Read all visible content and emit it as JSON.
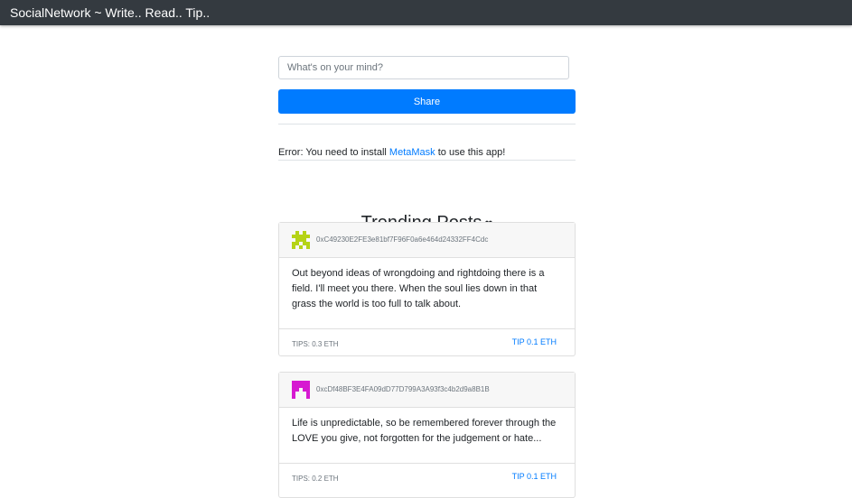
{
  "navbar": {
    "brand": "SocialNetwork ~ Write.. Read.. Tip.."
  },
  "composer": {
    "placeholder": "What's on your mind?",
    "value": "",
    "share_label": "Share"
  },
  "error": {
    "prefix": "Error: You need to install",
    "link_text": "MetaMask",
    "suffix": "to use this app!"
  },
  "trending": {
    "title": "Trending Posts",
    "icon": "heart-icon"
  },
  "posts": [
    {
      "author": "0xC49230E2FE3e81bf7F96F0a6e464d24332FF4Cdc",
      "avatar": "identicon-green",
      "avatar_color": "#b5d316",
      "content": "Out beyond ideas of wrongdoing and rightdoing there is a field. I'll meet you there. When the soul lies down in that grass the world is too full to talk about.",
      "tips": "TIPS: 0.3 ETH",
      "tip_label": "TIP 0.1 ETH"
    },
    {
      "author": "0xcDf48BF3E4FA09dD77D799A3A93f3c4b2d9a8B1B",
      "avatar": "identicon-magenta",
      "avatar_color": "#d61ad1",
      "content": "Life is unpredictable, so be remembered forever through the LOVE you give, not forgotten for the judgement or hate...",
      "tips": "TIPS: 0.2 ETH",
      "tip_label": "TIP 0.1 ETH"
    }
  ],
  "colors": {
    "navbar": "#343a40",
    "primary": "#007bff",
    "card_header": "#f7f7f7"
  }
}
